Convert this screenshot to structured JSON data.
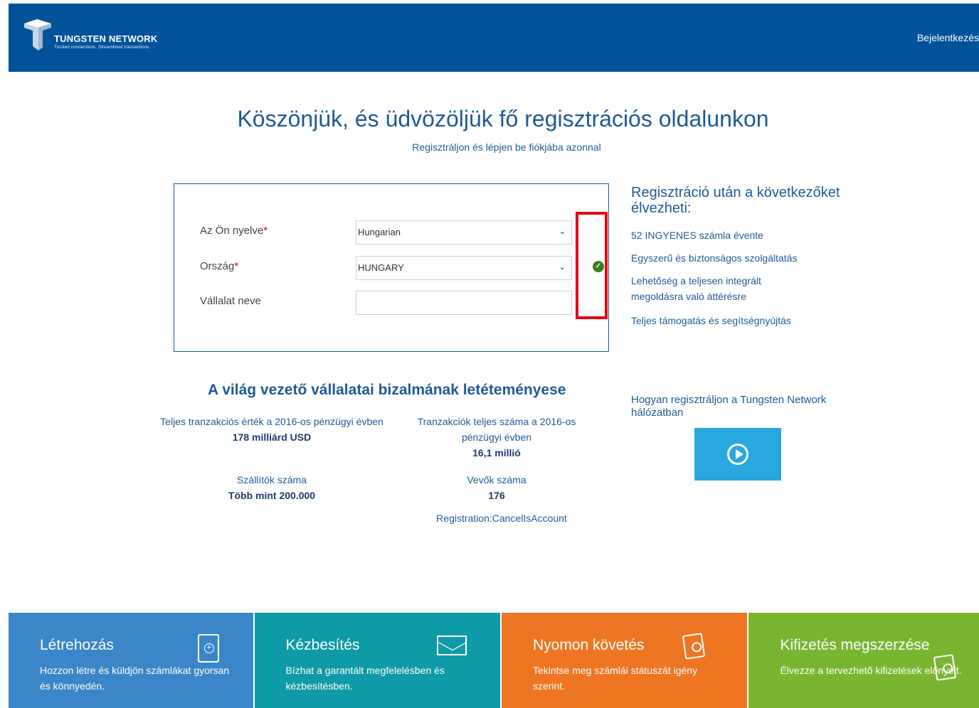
{
  "header": {
    "brand": "TUNGSTEN NETWORK",
    "tagline": "Trusted connections. Streamlined transactions.",
    "login": "Bejelentkezés"
  },
  "hero": {
    "title": "Köszönjük, és üdvözöljük fő regisztrációs oldalunkon",
    "subtitle": "Regisztráljon és lépjen be fiókjába azonnal"
  },
  "form": {
    "language_label": "Az Ön nyelve",
    "language_value": "Hungarian",
    "country_label": "Ország",
    "country_value": "HUNGARY",
    "company_label": "Vállalat neve",
    "company_value": "",
    "required_mark": "*"
  },
  "benefits": {
    "title": "Regisztráció után a következőket élvezheti:",
    "items": [
      "52 INGYENES számla évente",
      "Egyszerű és biztonságos szolgáltatás",
      "Lehetőség a teljesen integrált megoldásra való áttérésre",
      "Teljes támogatás és segítségnyújtás"
    ]
  },
  "trust": {
    "title": "A világ vezető vállalatai bizalmának letéteményese",
    "stats": [
      {
        "label": "Teljes tranzakciós érték a 2016-os pénzügyi évben",
        "value": "178 milliárd USD"
      },
      {
        "label": "Tranzakciók teljes száma a 2016-os pénzügyi évben",
        "value": "16,1 millió"
      },
      {
        "label": "Szállítók száma",
        "value": "Több mint 200.000"
      },
      {
        "label": "Vevők száma",
        "value": "176"
      }
    ],
    "footnote": "Registration:CancelIsAccount"
  },
  "video": {
    "title": "Hogyan regisztráljon a Tungsten Network hálózatban"
  },
  "tiles": [
    {
      "title": "Létrehozás",
      "text": "Hozzon létre és küldjön számlákat gyorsan és könnyedén.",
      "color": "#3a86c8",
      "icon": "document-add-icon"
    },
    {
      "title": "Kézbesítés",
      "text": "Bízhat a garantált megfelelésben és kézbesítésben.",
      "color": "#0e9aa7",
      "icon": "envelope-icon"
    },
    {
      "title": "Nyomon követés",
      "text": "Tekintse meg számlái státuszát igény szerint.",
      "color": "#ee7623",
      "icon": "document-search-icon"
    },
    {
      "title": "Kifizetés megszerzése",
      "text": "Élvezze a tervezhető kifizetések előnyeit.",
      "color": "#7ab531",
      "icon": "document-search-icon"
    }
  ]
}
